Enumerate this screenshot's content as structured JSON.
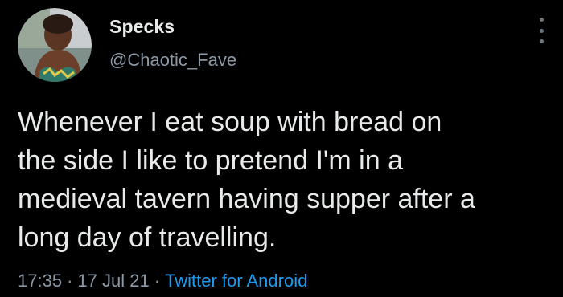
{
  "tweet": {
    "author": {
      "display_name": "Specks",
      "handle": "@Chaotic_Fave",
      "avatar_icon": "profile-avatar"
    },
    "text": "Whenever I eat soup with bread on\nthe side I like to pretend I'm in a\nmedieval tavern having supper after a\nlong day of travelling.",
    "time": "17:35",
    "separator": "·",
    "date": "17 Jul 21",
    "source": "Twitter for Android"
  },
  "colors": {
    "background": "#000000",
    "text": "#e7e9ea",
    "secondary_text": "#8b98a5",
    "link": "#1d9bf0"
  },
  "icons": {
    "more": "more-vertical-icon"
  }
}
